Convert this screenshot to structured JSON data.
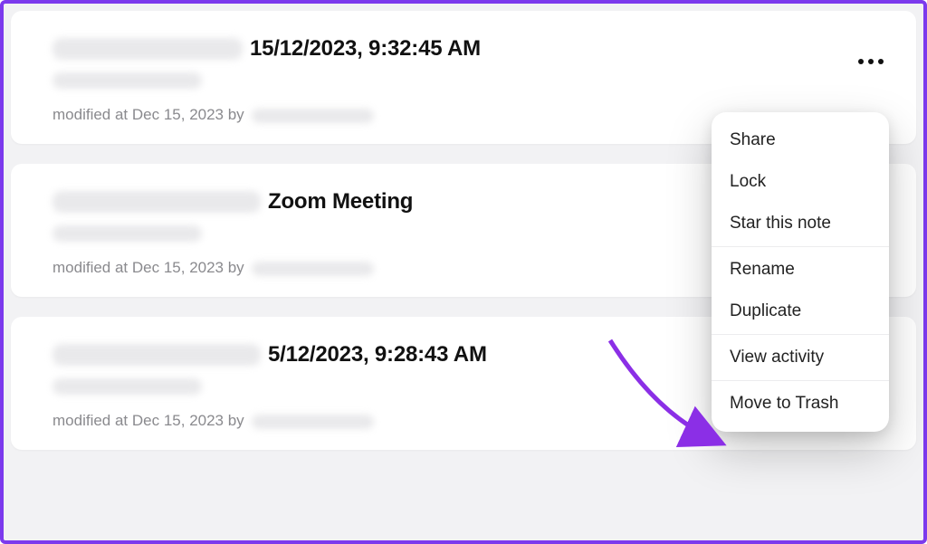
{
  "notes": [
    {
      "title_visible": "15/12/2023, 9:32:45 AM",
      "modified_prefix": "modified at Dec 15, 2023 by"
    },
    {
      "title_visible": "Zoom Meeting",
      "modified_prefix": "modified at Dec 15, 2023 by"
    },
    {
      "title_visible": "5/12/2023, 9:28:43 AM",
      "modified_prefix": "modified at Dec 15, 2023 by"
    }
  ],
  "menu": {
    "share": "Share",
    "lock": "Lock",
    "star": "Star this note",
    "rename": "Rename",
    "duplicate": "Duplicate",
    "view_activity": "View activity",
    "move_to_trash": "Move to Trash"
  }
}
